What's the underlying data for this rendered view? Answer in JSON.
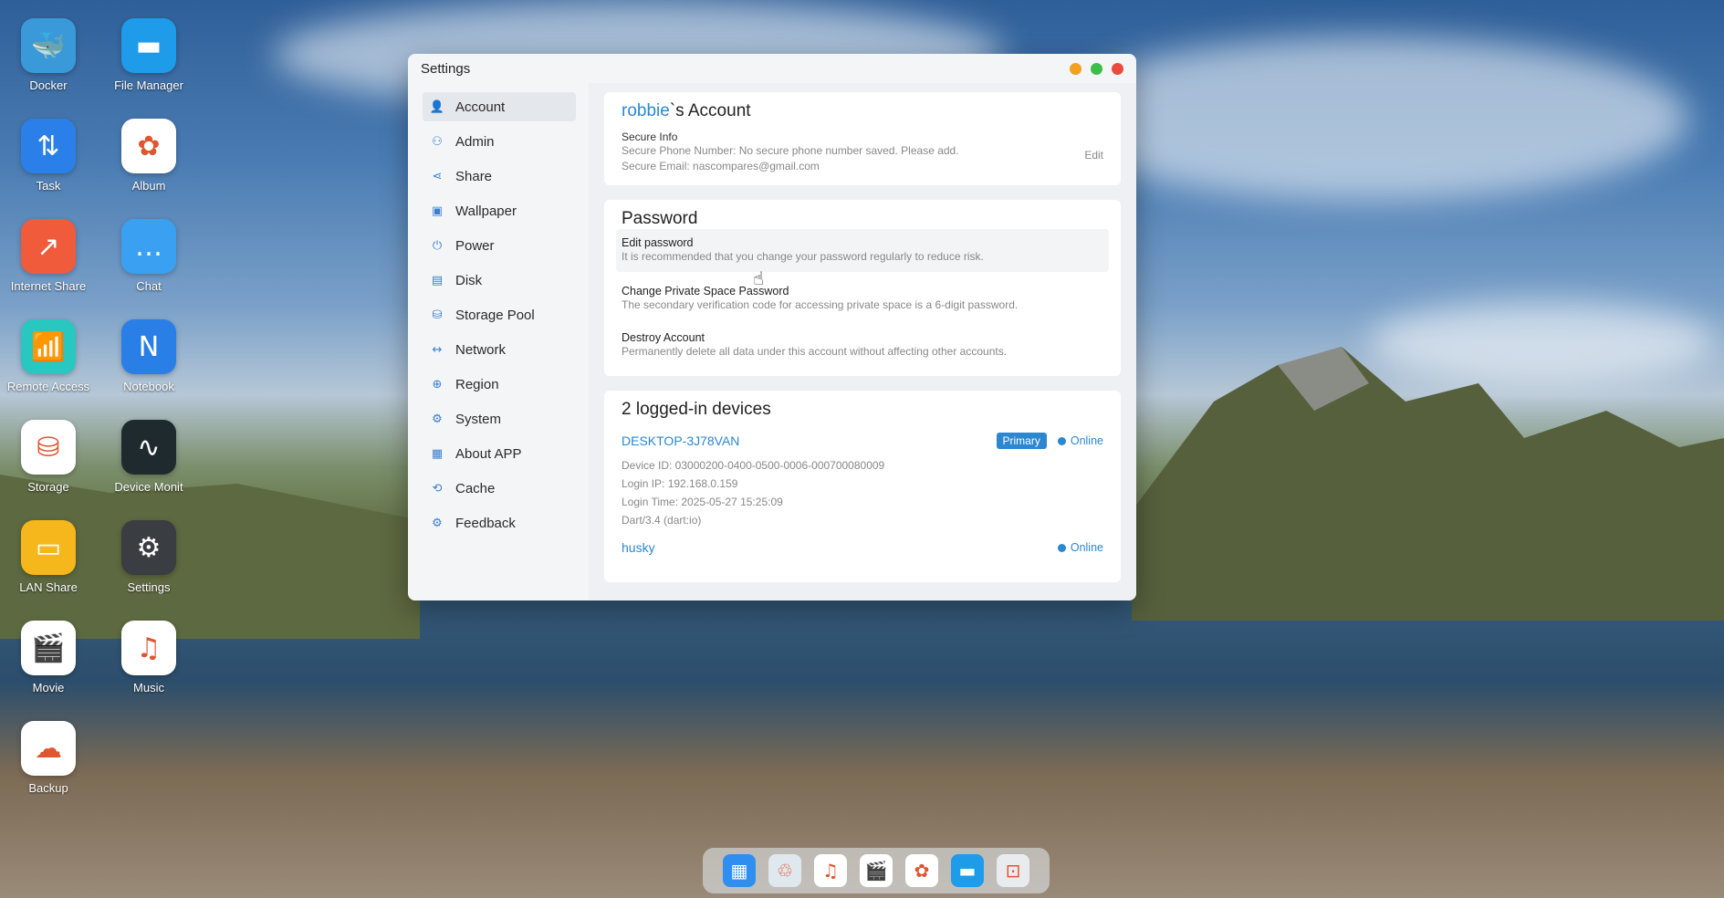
{
  "desktop": {
    "icons": [
      {
        "label": "Docker",
        "glyph": "🐳",
        "color": "#3a9ad9"
      },
      {
        "label": "File Manager",
        "glyph": "▬",
        "color": "#1e9be9"
      },
      {
        "label": "Task",
        "glyph": "⇅",
        "color": "#2a80e8"
      },
      {
        "label": "Album",
        "glyph": "✿",
        "color": "#ffffff"
      },
      {
        "label": "Internet Share",
        "glyph": "↗",
        "color": "#ef5b3b"
      },
      {
        "label": "Chat",
        "glyph": "…",
        "color": "#3aa0f2"
      },
      {
        "label": "Remote Access",
        "glyph": "📶",
        "color": "#28c7c0"
      },
      {
        "label": "Notebook",
        "glyph": "N",
        "color": "#2a7fe6"
      },
      {
        "label": "Storage",
        "glyph": "⛁",
        "color": "#ffffff"
      },
      {
        "label": "Device Monit",
        "glyph": "∿",
        "color": "#1f2a2f"
      },
      {
        "label": "LAN Share",
        "glyph": "▭",
        "color": "#f5b71b"
      },
      {
        "label": "Settings",
        "glyph": "⚙",
        "color": "#3a3d42"
      },
      {
        "label": "Movie",
        "glyph": "🎬",
        "color": "#ffffff"
      },
      {
        "label": "Music",
        "glyph": "♫",
        "color": "#ffffff"
      },
      {
        "label": "Backup",
        "glyph": "☁",
        "color": "#ffffff"
      }
    ]
  },
  "window": {
    "title": "Settings",
    "controls": {
      "minimize": "#f1a021",
      "maximize": "#3cbf4a",
      "close": "#ed4a3f"
    }
  },
  "sidebar": {
    "items": [
      {
        "label": "Account",
        "icon": "user-icon",
        "glyph": "👤"
      },
      {
        "label": "Admin",
        "icon": "admin-icon",
        "glyph": "⚇"
      },
      {
        "label": "Share",
        "icon": "share-icon",
        "glyph": "⋖"
      },
      {
        "label": "Wallpaper",
        "icon": "wallpaper-icon",
        "glyph": "▣"
      },
      {
        "label": "Power",
        "icon": "power-icon",
        "glyph": "⏻"
      },
      {
        "label": "Disk",
        "icon": "disk-icon",
        "glyph": "▤"
      },
      {
        "label": "Storage Pool",
        "icon": "storage-pool-icon",
        "glyph": "⛁"
      },
      {
        "label": "Network",
        "icon": "network-icon",
        "glyph": "↔"
      },
      {
        "label": "Region",
        "icon": "globe-icon",
        "glyph": "⊕"
      },
      {
        "label": "System",
        "icon": "system-gear-icon",
        "glyph": "⚙"
      },
      {
        "label": "About APP",
        "icon": "grid-icon",
        "glyph": "▦"
      },
      {
        "label": "Cache",
        "icon": "cache-icon",
        "glyph": "⟲"
      },
      {
        "label": "Feedback",
        "icon": "feedback-icon",
        "glyph": "⚙"
      }
    ]
  },
  "account": {
    "username": "robbie",
    "title_suffix": "`s Account",
    "secure_info": "Secure Info",
    "phone": "Secure Phone Number:  No secure phone number saved. Please add.",
    "email": "Secure Email:  nascompares@gmail.com",
    "edit": "Edit"
  },
  "password": {
    "heading": "Password",
    "rows": [
      {
        "title": "Edit password",
        "desc": "It is recommended that you change your password regularly to reduce risk."
      },
      {
        "title": "Change Private Space Password",
        "desc": "The secondary verification code for accessing private space is a 6-digit password."
      },
      {
        "title": "Destroy Account",
        "desc": "Permanently delete all data under this account without affecting other accounts."
      }
    ]
  },
  "devices": {
    "heading": "2 logged-in devices",
    "list": [
      {
        "name": "DESKTOP-3J78VAN",
        "badge": "Primary",
        "status": "Online",
        "device_id": "Device ID:  03000200-0400-0500-0006-000700080009",
        "login_ip": "Login IP:  192.168.0.159",
        "login_time": "Login Time:  2025-05-27 15:25:09",
        "agent": "Dart/3.4 (dart:io)"
      },
      {
        "name": "husky",
        "status": "Online"
      }
    ]
  },
  "dock": {
    "items": [
      {
        "name": "apps-icon",
        "glyph": "▦",
        "color": "#2f8ff0"
      },
      {
        "name": "recycle-icon",
        "glyph": "♲",
        "color": "#dfe8ee"
      },
      {
        "name": "music-icon",
        "glyph": "♫",
        "color": "#ffffff"
      },
      {
        "name": "movie-icon",
        "glyph": "🎬",
        "color": "#ffffff"
      },
      {
        "name": "album-icon",
        "glyph": "✿",
        "color": "#ffffff"
      },
      {
        "name": "folder-icon",
        "glyph": "▬",
        "color": "#1e9be9"
      },
      {
        "name": "screenshot-icon",
        "glyph": "⊡",
        "color": "#e9ecef"
      }
    ]
  }
}
